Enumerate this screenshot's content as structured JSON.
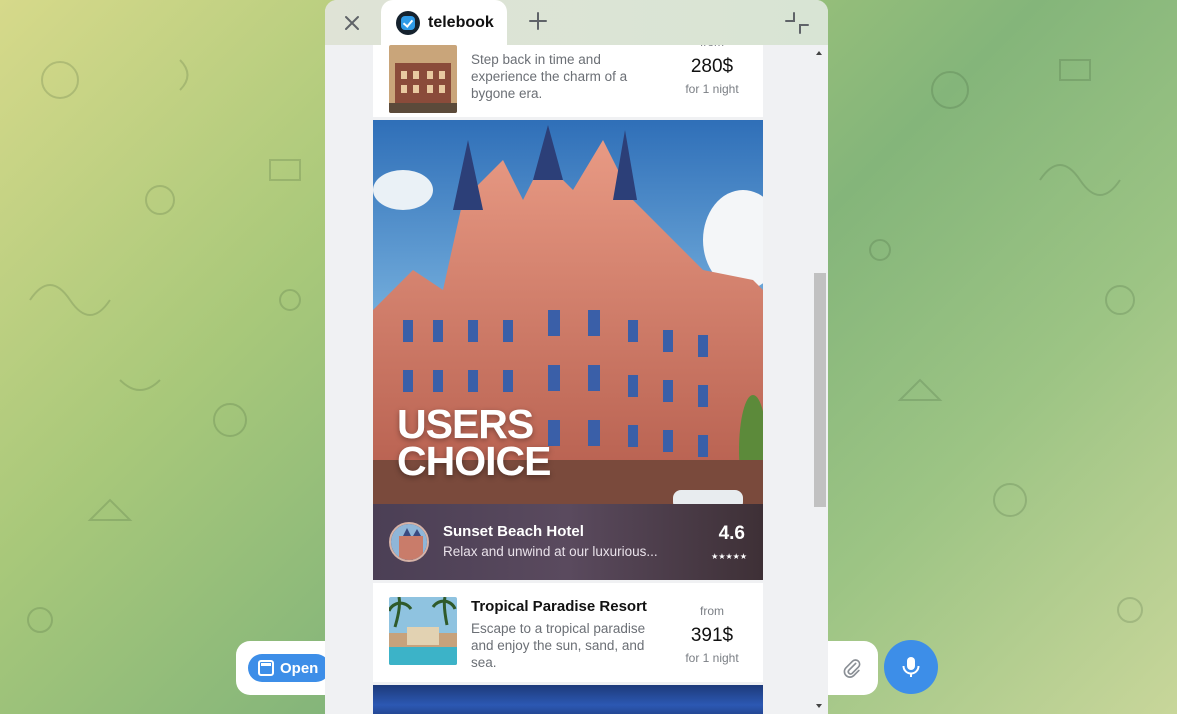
{
  "window": {
    "tab_title": "telebook"
  },
  "hotels": [
    {
      "title": "",
      "description": "Step back in time and experience the charm of a bygone era.",
      "from_label": "from",
      "price": "280$",
      "per_label": "for 1 night"
    },
    {
      "title": "Tropical Paradise Resort",
      "description": "Escape to a tropical paradise and enjoy the sun, sand, and sea.",
      "from_label": "from",
      "price": "391$",
      "per_label": "for 1 night"
    }
  ],
  "featured": {
    "badge": "USERS\nCHOICE",
    "name": "Sunset Beach Hotel",
    "description": "Relax and unwind at our luxurious...",
    "rating": "4.6",
    "stars": "★★★★★"
  },
  "chat": {
    "open_button": "Open"
  },
  "icons": {
    "close": "close-icon",
    "add_tab": "plus-icon",
    "collapse": "collapse-icon",
    "attach": "paperclip-icon",
    "mic": "microphone-icon"
  },
  "colors": {
    "accent": "#3d8ee8",
    "window_bg": "#f0f1f3"
  }
}
